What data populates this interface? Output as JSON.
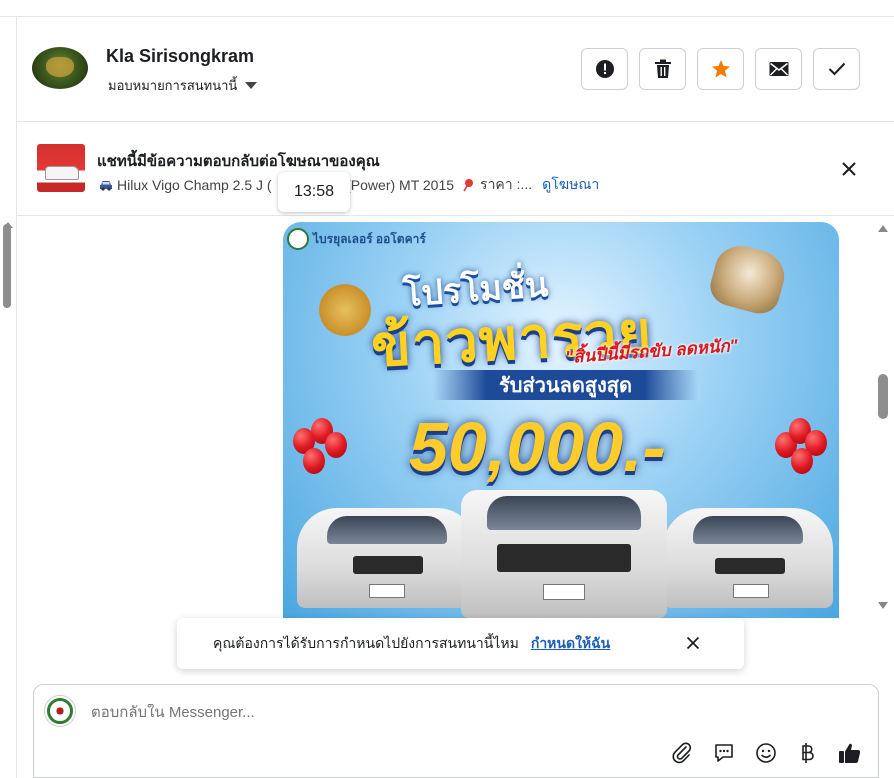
{
  "header": {
    "contact_name": "Kla Sirisongkram",
    "assign_label": "มอบหมายการสนทนานี้",
    "actions": [
      {
        "name": "spam-button",
        "icon": "alert-icon"
      },
      {
        "name": "delete-button",
        "icon": "trash-icon"
      },
      {
        "name": "star-button",
        "icon": "star-icon",
        "color": "#f57c00"
      },
      {
        "name": "mark-unread-button",
        "icon": "envelope-icon"
      },
      {
        "name": "mark-done-button",
        "icon": "check-icon"
      }
    ]
  },
  "ad_banner": {
    "title": "แชทนี้มีข้อความตอบกลับต่อโฆษณาของคุณ",
    "subtitle_prefix": "Hilux Vigo Champ 2.5 J (",
    "subtitle_middle": ") (Power) MT 2015",
    "price_label": "ราคา :...",
    "view_ad_link": "ดูโฆษณา"
  },
  "tooltip": {
    "time": "13:58"
  },
  "promo_image": {
    "brand": "ไบรยุลเลอร์ ออโตคาร์",
    "line1": "โปรโมชั่น",
    "line2": "ข้าวพารวย",
    "line3": "\"สิ้นปีนี้มีรถขับ ลดหนัก\"",
    "band": "รับส่วนลดสูงสุด",
    "amount": "50,000.-"
  },
  "notification": {
    "text": "คุณต้องการได้รับการกำหนดไปยังการสนทนานี้ไหม",
    "link": "กำหนดให้ฉัน"
  },
  "composer": {
    "placeholder": "ตอบกลับใน Messenger...",
    "tools": [
      "attach-icon",
      "saved-reply-icon",
      "emoji-icon",
      "baht-icon",
      "thumbs-up-icon"
    ],
    "like_color": "#1c1e21"
  },
  "colors": {
    "link": "#1a5fb4",
    "border": "#ccd0d5",
    "star": "#f57c00"
  }
}
